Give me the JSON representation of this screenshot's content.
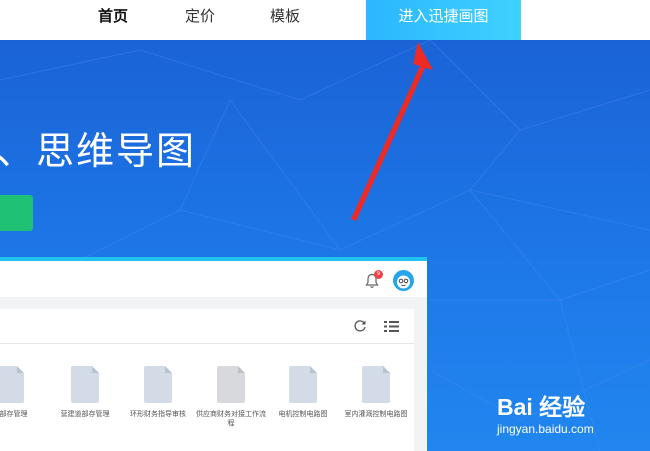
{
  "nav": {
    "home": "首页",
    "pricing": "定价",
    "templates": "模板",
    "cta": "进入迅捷画图"
  },
  "hero": {
    "title": "、思维导图"
  },
  "app": {
    "notification_count": "9",
    "files": [
      {
        "label": "道部存管理",
        "style": "blue"
      },
      {
        "label": "营建道部存管理",
        "style": "blue"
      },
      {
        "label": "环形财务指导审核",
        "style": "blue"
      },
      {
        "label": "供应商财务对接工作流程",
        "style": "grey"
      },
      {
        "label": "电机控制电路图",
        "style": "blue"
      },
      {
        "label": "室内灌溉控制电路图",
        "style": "blue"
      }
    ]
  },
  "watermark": {
    "brand": "Bai 经验",
    "url": "jingyan.baidu.com"
  },
  "colors": {
    "cta_bg": "#2bb6ff",
    "hero_bg": "#1e78e8",
    "accent_green": "#1fc274",
    "arrow": "#ee2a24"
  }
}
